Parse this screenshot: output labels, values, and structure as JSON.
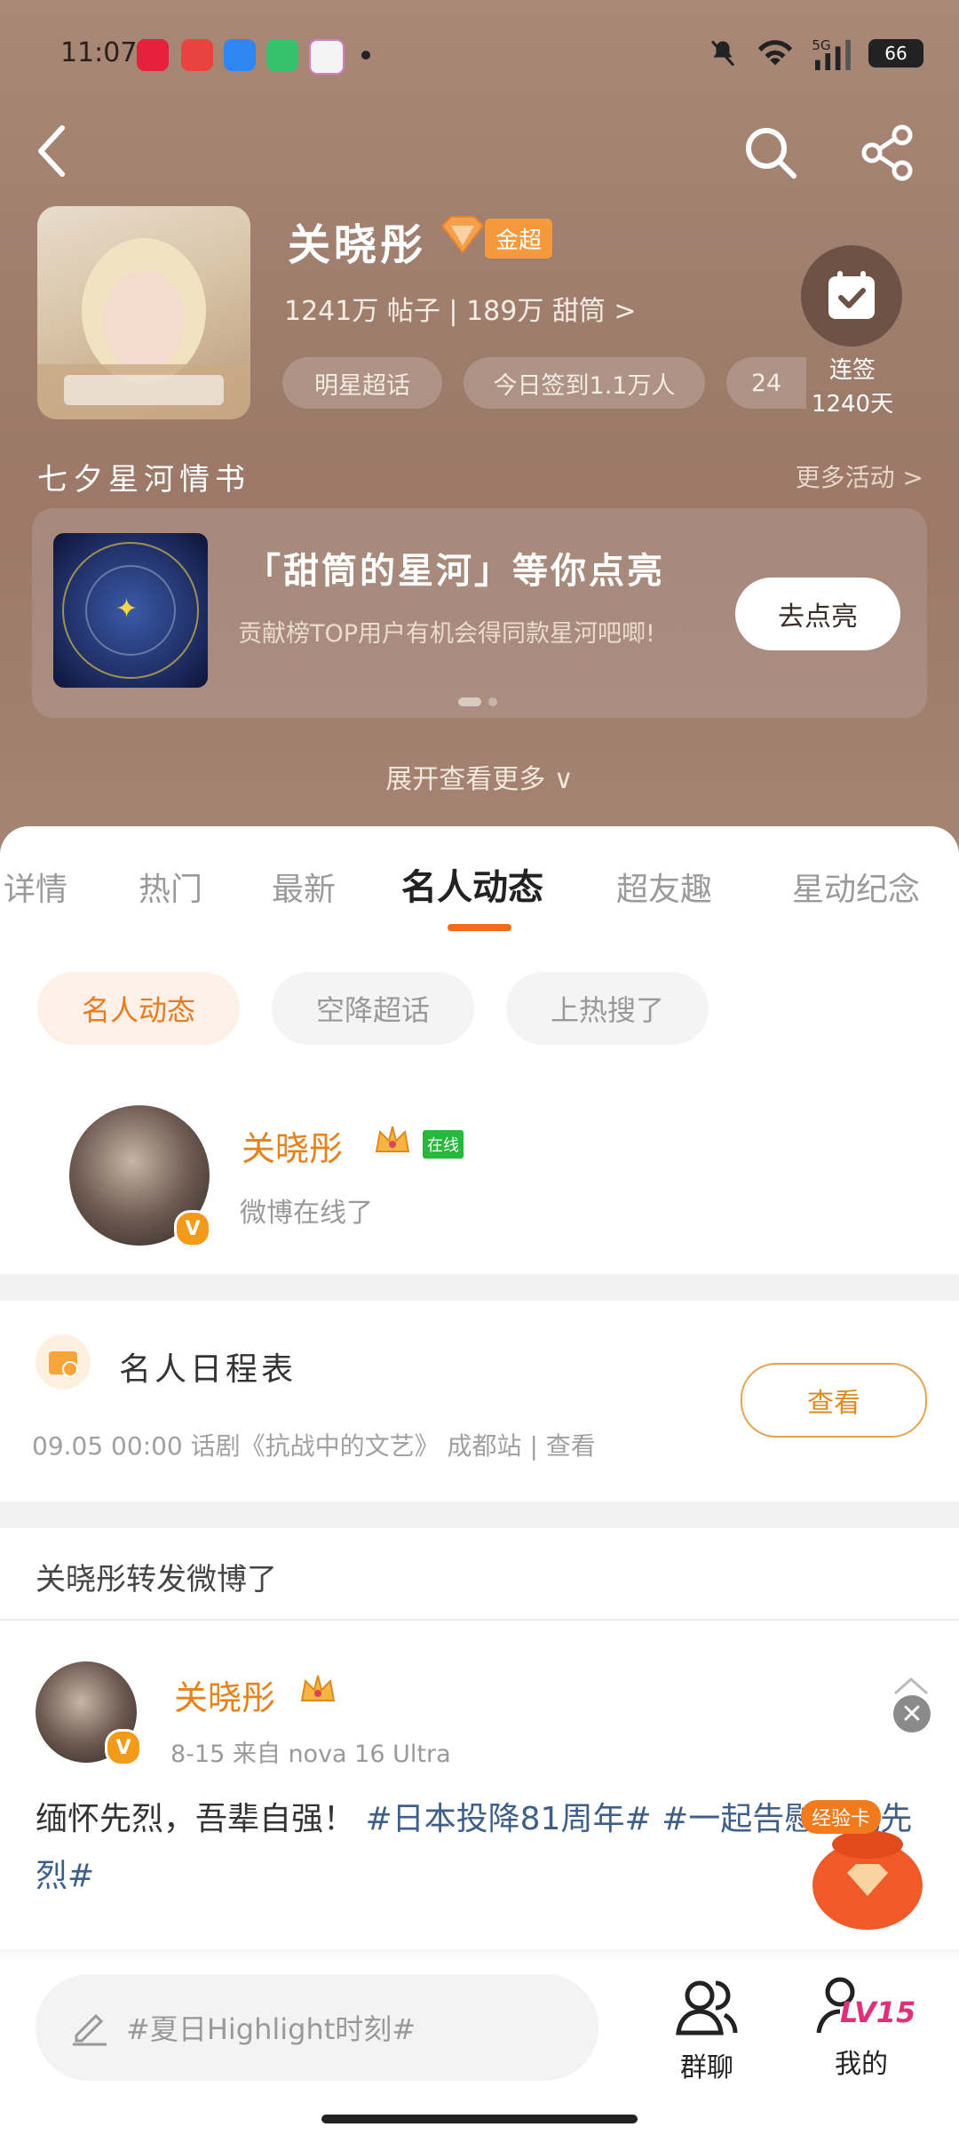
{
  "status": {
    "time": "11:07",
    "battery": "66",
    "network": "5G"
  },
  "header": {
    "title": "关晓彤",
    "badge": "金超",
    "stats": "1241万 帖子 | 189万 甜筒 >",
    "pills": [
      "明星超话",
      "今日签到1.1万人",
      "24"
    ],
    "checkin_label1": "连签",
    "checkin_label2": "1240天"
  },
  "activity": {
    "section_title": "七夕星河情书",
    "more_link": "更多活动 >",
    "promo_title": "「甜筒的星河」等你点亮",
    "promo_desc": "贡献榜TOP用户有机会得同款星河吧唧!",
    "promo_button": "去点亮",
    "expand": "展开查看更多 ∨"
  },
  "tabs": [
    {
      "label": "详情",
      "active": false
    },
    {
      "label": "热门",
      "active": false
    },
    {
      "label": "最新",
      "active": false
    },
    {
      "label": "名人动态",
      "active": true
    },
    {
      "label": "超友趣",
      "active": false
    },
    {
      "label": "星动纪念",
      "active": false
    }
  ],
  "chips": [
    {
      "label": "名人动态",
      "active": true
    },
    {
      "label": "空降超话",
      "active": false
    },
    {
      "label": "上热搜了",
      "active": false
    }
  ],
  "celebrity": {
    "name": "关晓彤",
    "online": "在线",
    "status": "微博在线了"
  },
  "schedule": {
    "title": "名人日程表",
    "detail": "09.05 00:00 话剧《抗战中的文艺》 成都站 | 查看",
    "button": "查看"
  },
  "repost_notice": "关晓彤转发微博了",
  "post": {
    "author": "关晓彤",
    "meta": "8-15 来自 nova 16 Ultra",
    "text_plain": "缅怀先烈，吾辈自强！",
    "hashtag1": "#日本投降81周年#",
    "hashtag2": "#一起告慰抗战先烈#",
    "exp_card": "经验卡"
  },
  "bottom": {
    "composer_placeholder": "#夏日Highlight时刻#",
    "group_chat": "群聊",
    "mine": "我的",
    "level": "LV15"
  },
  "colors": {
    "accent": "#f26b1d",
    "orange_name": "#e6811b",
    "hashtag": "#3f5f8a"
  }
}
